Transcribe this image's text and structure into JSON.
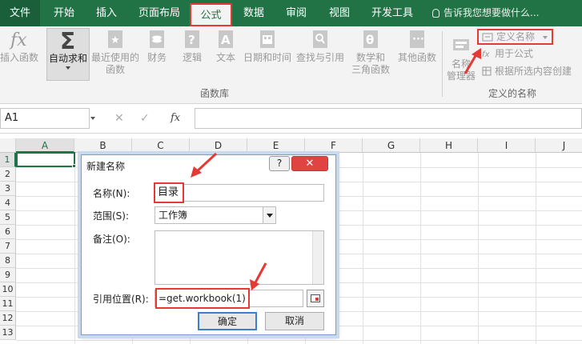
{
  "tabs": [
    {
      "label": "文件"
    },
    {
      "label": "开始"
    },
    {
      "label": "插入"
    },
    {
      "label": "页面布局"
    },
    {
      "label": "公式"
    },
    {
      "label": "数据"
    },
    {
      "label": "审阅"
    },
    {
      "label": "视图"
    },
    {
      "label": "开发工具"
    }
  ],
  "tell_me": "告诉我您想要做什么...",
  "ribbon": {
    "insert_function": "插入函数",
    "autosum": "自动求和",
    "recent_line1": "最近使用的",
    "recent_line2": "函数",
    "financial": "财务",
    "logical": "逻辑",
    "text": "文本",
    "datetime": "日期和时间",
    "lookup": "查找与引用",
    "math_line1": "数学和",
    "math_line2": "三角函数",
    "more": "其他函数",
    "library_label": "函数库",
    "name_manager_line1": "名称",
    "name_manager_line2": "管理器",
    "define_name": "定义名称",
    "use_in_formula": "用于公式",
    "create_from_selection": "根据所选内容创建",
    "defined_names_label": "定义的名称"
  },
  "formula_bar": {
    "name_box": "A1",
    "fx": "fx"
  },
  "grid": {
    "columns": [
      "A",
      "B",
      "C",
      "D",
      "E",
      "F",
      "G",
      "H",
      "I",
      "J"
    ],
    "rows": [
      "1",
      "2",
      "3",
      "4",
      "5",
      "6",
      "7",
      "8",
      "9",
      "10",
      "11",
      "12",
      "13"
    ]
  },
  "dialog": {
    "title": "新建名称",
    "help": "?",
    "close": "✕",
    "name_label": "名称(N):",
    "name_value": "目录",
    "scope_label": "范围(S):",
    "scope_value": "工作簿",
    "comment_label": "备注(O):",
    "ref_label": "引用位置(R):",
    "ref_value": "=get.workbook(1)",
    "ok": "确定",
    "cancel": "取消"
  },
  "colors": {
    "excel_green": "#217346",
    "highlight_red": "#e53935"
  }
}
